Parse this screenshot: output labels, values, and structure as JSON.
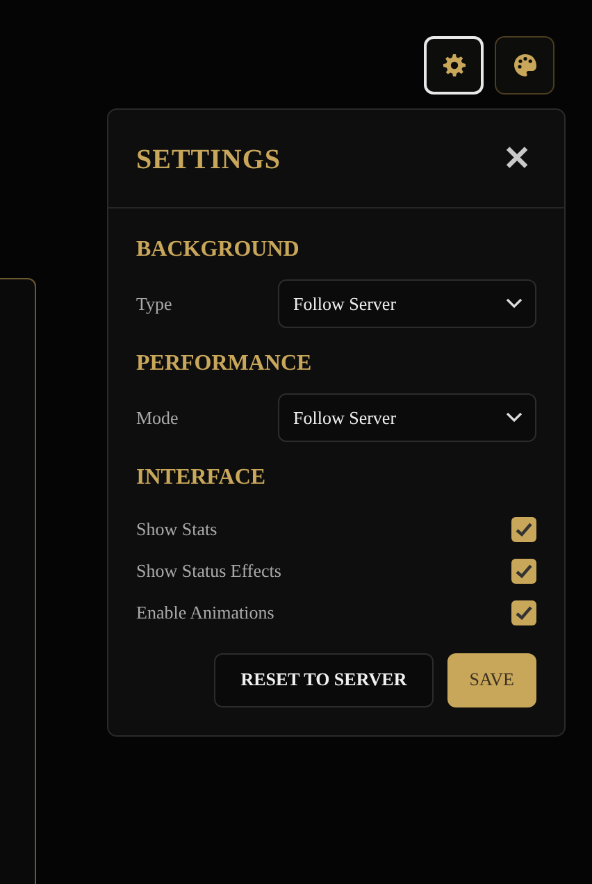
{
  "toolbar": [
    {
      "kind": "gear",
      "selected": true
    },
    {
      "kind": "palette",
      "selected": false
    }
  ],
  "settings": {
    "title": "SETTINGS",
    "close": "✕",
    "sections": [
      {
        "heading": "BACKGROUND",
        "kind": "select",
        "label": "Type",
        "value": "Follow Server"
      },
      {
        "heading": "PERFORMANCE",
        "kind": "select",
        "label": "Mode",
        "value": "Follow Server"
      },
      {
        "heading": "INTERFACE",
        "kind": "checks",
        "options": [
          {
            "label": "Show Stats",
            "checked": true
          },
          {
            "label": "Show Status Effects",
            "checked": true
          },
          {
            "label": "Enable Animations",
            "checked": true
          }
        ]
      }
    ],
    "buttons": [
      {
        "label": "RESET TO SERVER",
        "kind": "secondary"
      },
      {
        "label": "SAVE",
        "kind": "primary"
      }
    ]
  }
}
